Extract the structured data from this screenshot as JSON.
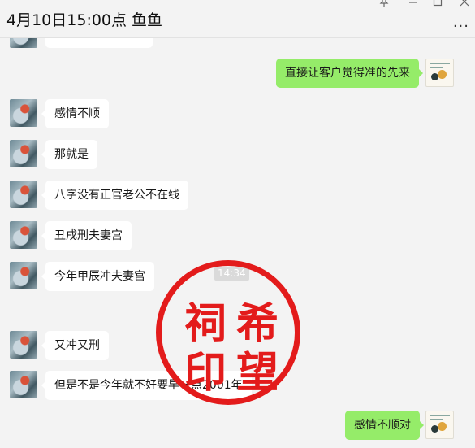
{
  "header": {
    "title": "4月10日15:00点 鱼鱼",
    "pin_icon": "pin-icon",
    "minimize_icon": "minimize-icon",
    "maximize_icon": "maximize-icon",
    "close_icon": "close-icon",
    "more_icon": "more-icon"
  },
  "messages": [
    {
      "side": "right",
      "text": "直接让客户觉得准的先来"
    },
    {
      "side": "left",
      "text": "感情不顺"
    },
    {
      "side": "left",
      "text": "那就是"
    },
    {
      "side": "left",
      "text": "八字没有正官老公不在线"
    },
    {
      "side": "left",
      "text": "丑戌刑夫妻宫"
    },
    {
      "side": "left",
      "text": "今年甲辰冲夫妻宫"
    },
    {
      "side": "left",
      "text": "又冲又刑"
    },
    {
      "side": "left",
      "text": "但是不是今年就不好要早一点2001年"
    },
    {
      "side": "right",
      "text": "感情不顺对"
    }
  ],
  "timestamp": "14:34",
  "seal": {
    "chars": [
      "祠",
      "希",
      "印",
      "望"
    ],
    "color": "#e31b1b"
  },
  "colors": {
    "right_bubble": "#95ec69",
    "left_bubble": "#ffffff",
    "background": "#f3f3f3"
  }
}
